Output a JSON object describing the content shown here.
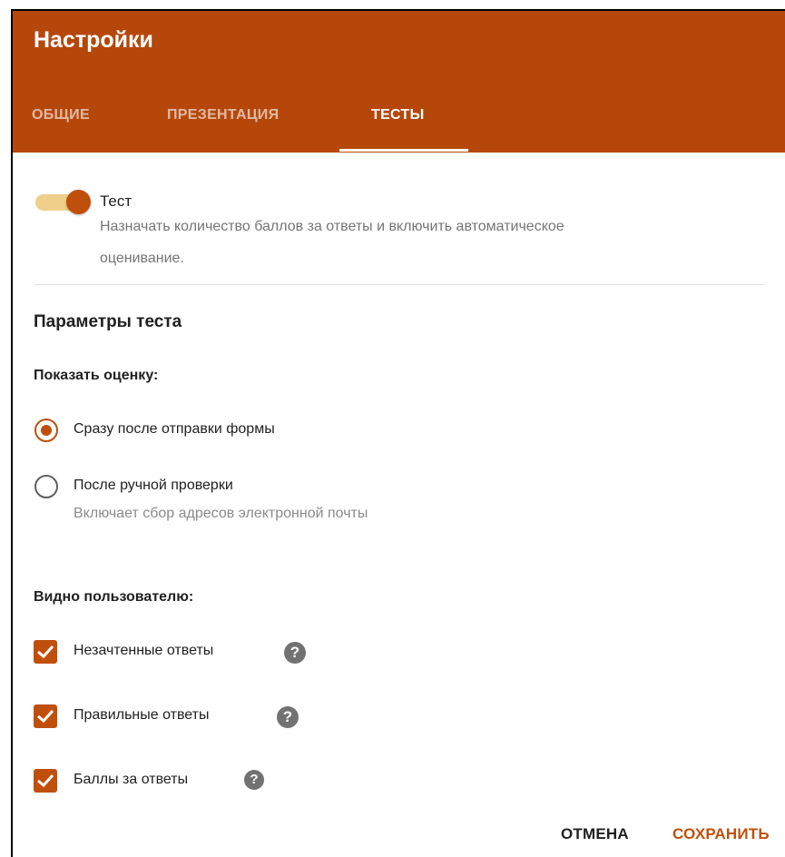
{
  "header": {
    "title": "Настройки"
  },
  "tabs": [
    {
      "label": "ОБЩИЕ",
      "active": false
    },
    {
      "label": "ПРЕЗЕНТАЦИЯ",
      "active": false
    },
    {
      "label": "ТЕСТЫ",
      "active": true
    }
  ],
  "quiz_toggle": {
    "on": true,
    "label": "Тест",
    "description_line1": "Назначать количество баллов за ответы и включить автоматическое",
    "description_line2": "оценивание."
  },
  "quiz_params": {
    "heading": "Параметры теста",
    "release_grade": {
      "label": "Показать оценку:",
      "options": [
        {
          "label": "Сразу после отправки формы",
          "selected": true
        },
        {
          "label": "После ручной проверки",
          "hint": "Включает сбор адресов электронной почты",
          "selected": false
        }
      ]
    },
    "respondent_can_see": {
      "label": "Видно пользователю:",
      "options": [
        {
          "label": "Незачтенные ответы",
          "checked": true
        },
        {
          "label": "Правильные ответы",
          "checked": true
        },
        {
          "label": "Баллы за ответы",
          "checked": true
        }
      ]
    }
  },
  "actions": {
    "cancel": "ОТМЕНА",
    "save": "СОХРАНИТЬ"
  },
  "icons": {
    "help": "help-circle-icon",
    "check": "checkmark-icon"
  },
  "help_glyph": "?",
  "colors": {
    "header": "#b5470b",
    "accent": "#c04f0c",
    "toggle_track": "#efcf8a"
  }
}
